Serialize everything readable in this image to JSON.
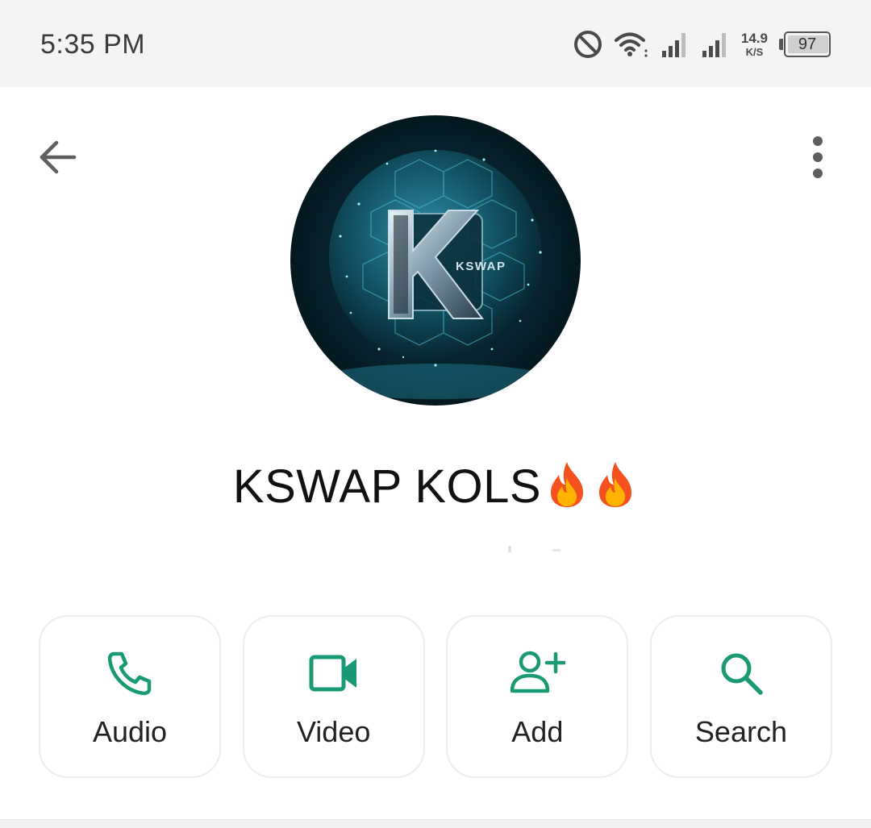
{
  "status_bar": {
    "time": "5:35 PM",
    "icons": [
      "do-not-disturb-icon",
      "wifi-icon",
      "signal-icon",
      "signal-icon"
    ],
    "net_speed_value": "14.9",
    "net_speed_unit": "K/S",
    "battery_level": "97",
    "battery_fraction": 0.97
  },
  "header": {
    "back_icon": "arrow-left-icon",
    "menu_icon": "more-vertical-icon"
  },
  "profile": {
    "name": "KSWAP KOLS",
    "avatar_text": "KSWAP"
  },
  "actions": [
    {
      "label": "Audio",
      "icon": "phone-icon"
    },
    {
      "label": "Video",
      "icon": "video-icon"
    },
    {
      "label": "Add",
      "icon": "add-user-icon"
    },
    {
      "label": "Search",
      "icon": "search-icon"
    }
  ],
  "colors": {
    "accent": "#1a9a74",
    "status_bar_bg": "#f4f4f4",
    "card_border": "#ededed"
  }
}
